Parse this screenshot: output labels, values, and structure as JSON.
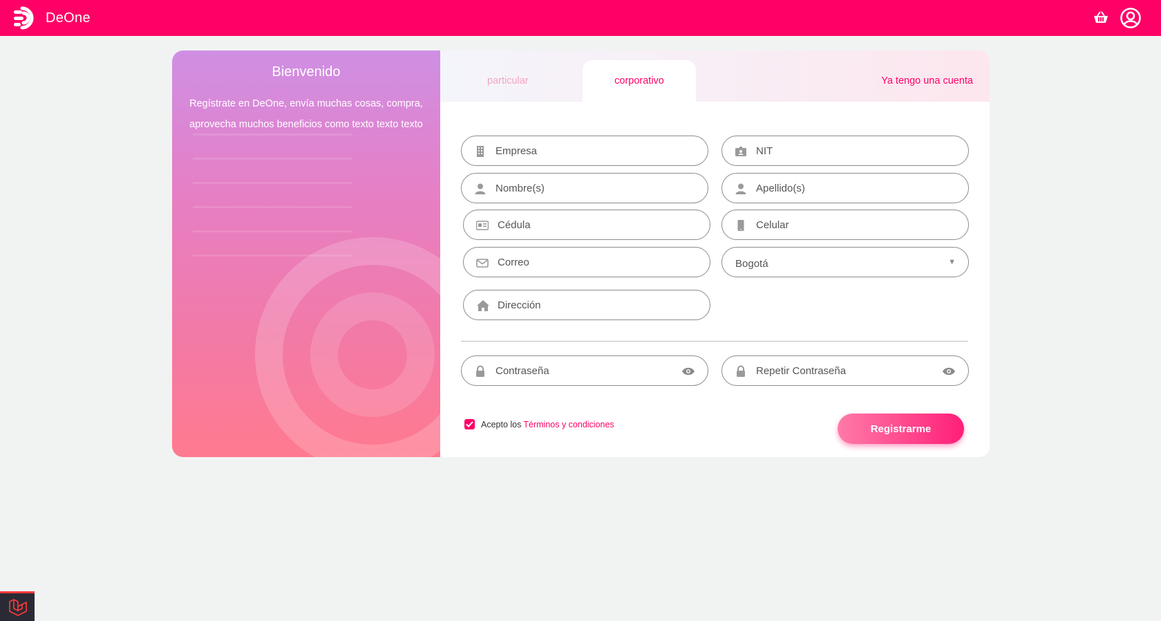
{
  "header": {
    "brand_name": "DeOne",
    "brand_color": "#ff0066",
    "icons": [
      "logo-icon",
      "basket-icon",
      "account-icon"
    ]
  },
  "welcome": {
    "title": "Bienvenido",
    "text": "Regístrate en DeOne, envía muchas cosas, compra, aprovecha muchos beneficios como texto texto texto"
  },
  "tabs": {
    "particular": "particular",
    "corporativo": "corporativo",
    "active": "corporativo",
    "login_link": "Ya tengo una cuenta"
  },
  "form": {
    "empresa": "Empresa",
    "nit": "NIT",
    "nombres": "Nombre(s)",
    "apellidos": "Apellido(s)",
    "cedula": "Cédula",
    "celular": "Celular",
    "correo": "Correo",
    "ciudad": "Bogotá",
    "direccion": "Dirección",
    "contrasena": "Contraseña",
    "repetir_contrasena": "Repetir Contraseña"
  },
  "terms": {
    "checked": true,
    "prefix": "Acepto los",
    "link": "Términos y condiciones"
  },
  "register_button": "Registrarme"
}
